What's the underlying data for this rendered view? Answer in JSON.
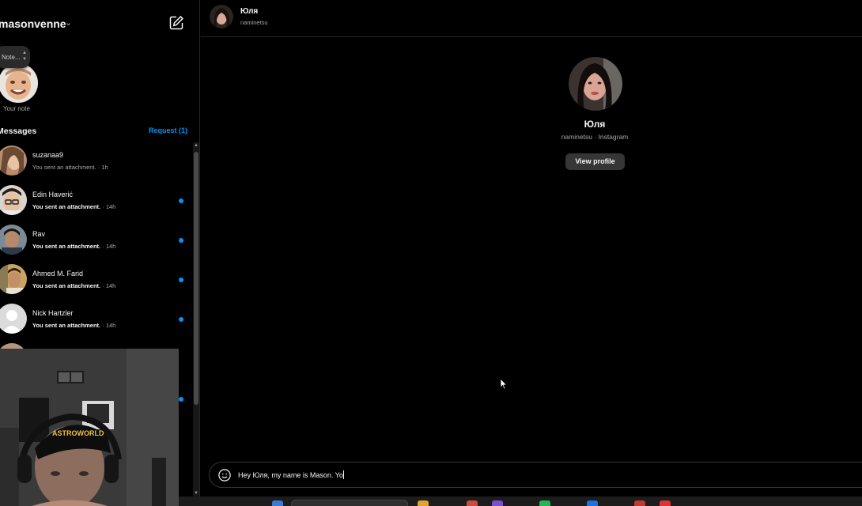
{
  "sidebar": {
    "username": "masonvenne",
    "note": {
      "bubble_text": "Note...",
      "caption": "Your note"
    },
    "messages_title": "Messages",
    "requests_label": "Request (1)",
    "conversations": [
      {
        "name": "suzanaa9",
        "preview": "You sent an attachment.",
        "time": "· 1h",
        "unread": false
      },
      {
        "name": "Edin Haverić",
        "preview": "You sent an attachment.",
        "time": "· 14h",
        "unread": true
      },
      {
        "name": "Rav",
        "preview": "You sent an attachment.",
        "time": "· 14h",
        "unread": true
      },
      {
        "name": "Ahmed M. Farid",
        "preview": "You sent an attachment.",
        "time": "· 14h",
        "unread": true
      },
      {
        "name": "Nick Hartzler",
        "preview": "You sent an attachment.",
        "time": "· 14h",
        "unread": true
      }
    ]
  },
  "chat": {
    "header": {
      "name": "Юля",
      "handle": "naminetsu"
    },
    "profile": {
      "name": "Юля",
      "subtitle": "naminetsu · Instagram",
      "view_profile_label": "View profile"
    },
    "composer": {
      "value": "Hey Юля, my name is Mason. Yo"
    }
  },
  "webcam": {
    "cap_text": "ASTROWORLD"
  },
  "colors": {
    "accent": "#0095f6",
    "background": "#000000",
    "button": "#363636",
    "muted_text": "#a8a8a8"
  },
  "icons": {
    "compose": "new-message-icon",
    "chevron": "chevron-down-icon",
    "emoji": "emoji-icon",
    "cursor": "mouse-pointer-icon"
  }
}
